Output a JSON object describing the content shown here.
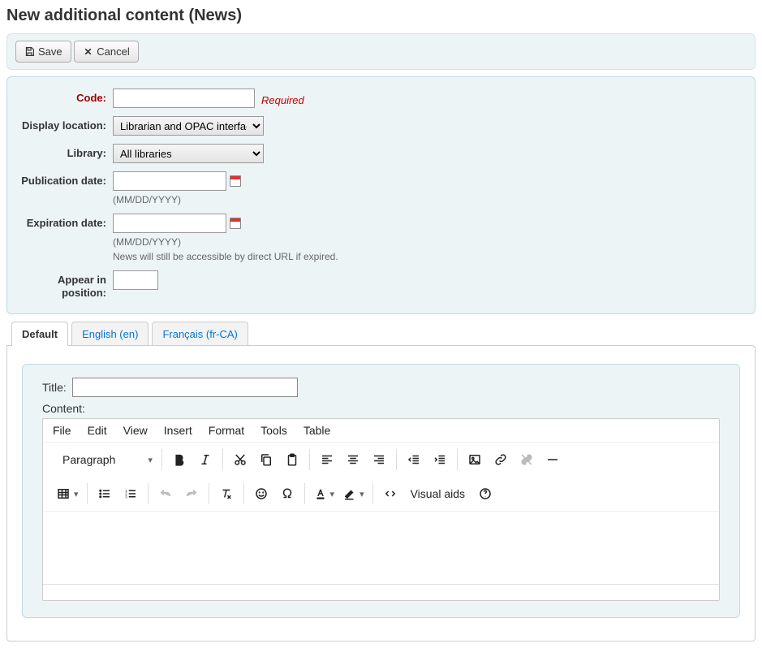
{
  "page_title": "New additional content (News)",
  "toolbar": {
    "save_label": "Save",
    "cancel_label": "Cancel"
  },
  "form": {
    "code": {
      "label": "Code:",
      "value": "",
      "required_text": "Required"
    },
    "display_location": {
      "label": "Display location:",
      "value": "Librarian and OPAC interfaces"
    },
    "library": {
      "label": "Library:",
      "value": "All libraries"
    },
    "pub_date": {
      "label": "Publication date:",
      "value": "",
      "hint": "(MM/DD/YYYY)"
    },
    "exp_date": {
      "label": "Expiration date:",
      "value": "",
      "hint1": "(MM/DD/YYYY)",
      "hint2": "News will still be accessible by direct URL if expired."
    },
    "position": {
      "label": "Appear in position:",
      "value": ""
    }
  },
  "tabs": [
    {
      "id": "default",
      "label": "Default",
      "active": true
    },
    {
      "id": "en",
      "label": "English (en)",
      "active": false
    },
    {
      "id": "frca",
      "label": "Français (fr-CA)",
      "active": false
    }
  ],
  "editor_panel": {
    "title_label": "Title:",
    "title_value": "",
    "content_label": "Content:"
  },
  "editor": {
    "menus": [
      "File",
      "Edit",
      "View",
      "Insert",
      "Format",
      "Tools",
      "Table"
    ],
    "block_format": "Paragraph",
    "visual_aids_label": "Visual aids"
  }
}
